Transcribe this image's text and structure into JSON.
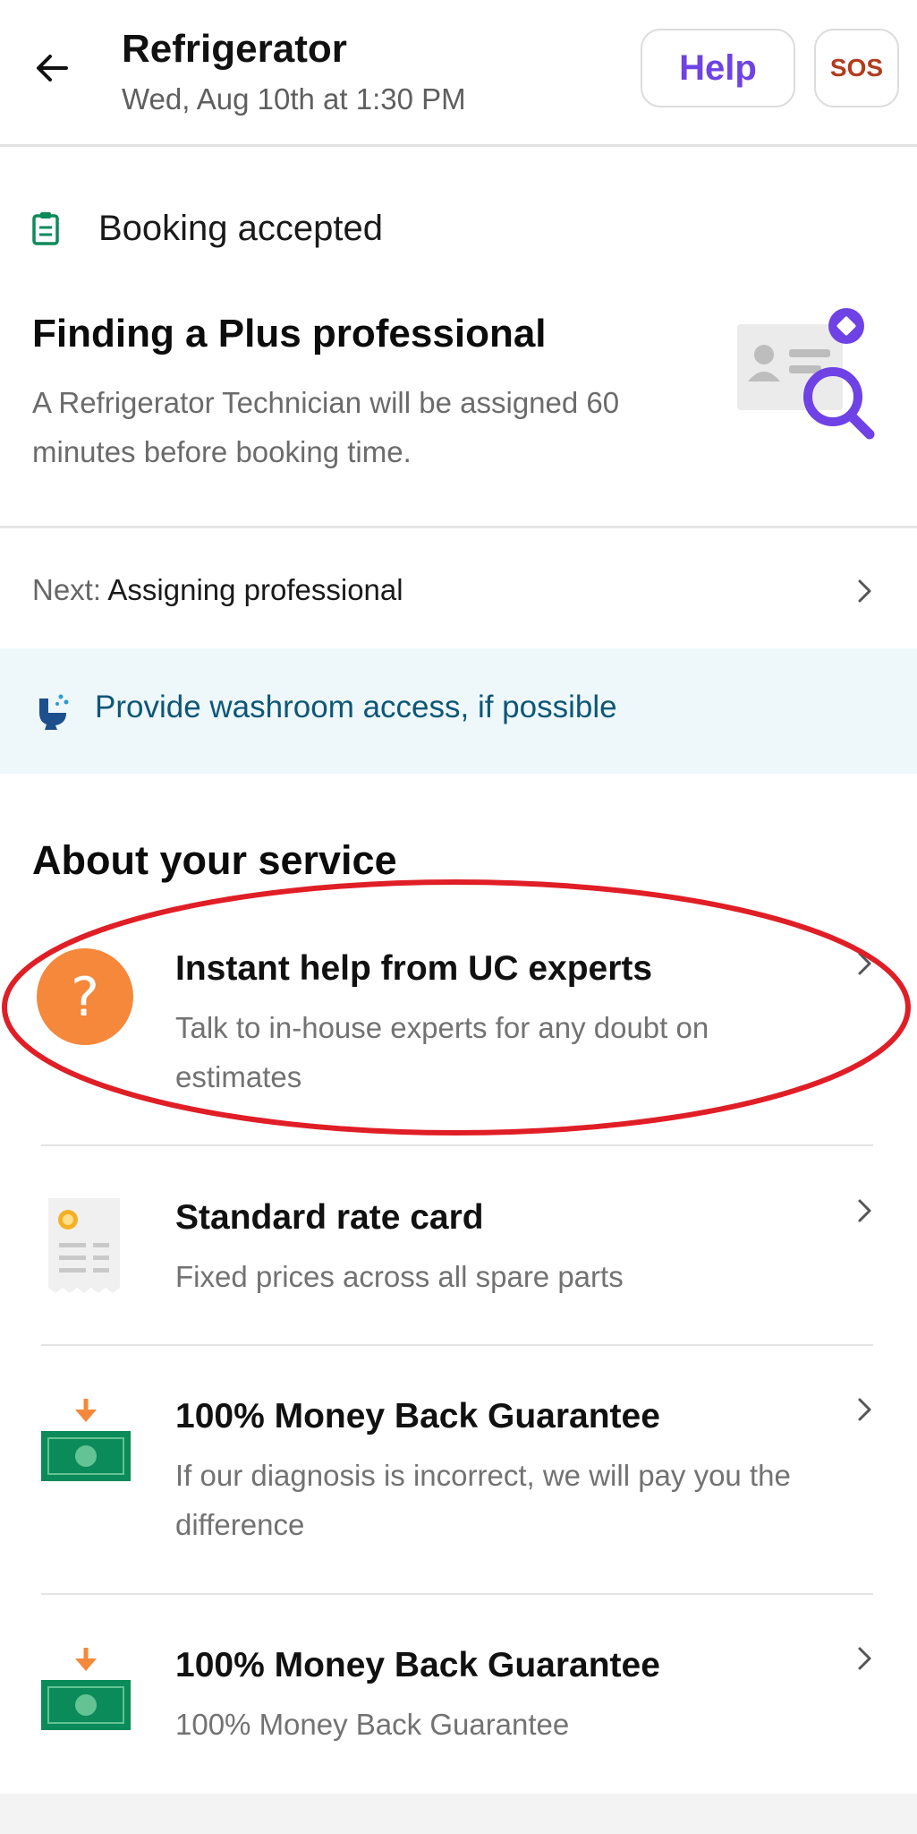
{
  "header": {
    "title": "Refrigerator",
    "subtitle": "Wed, Aug 10th at 1:30 PM",
    "help_label": "Help",
    "sos_label": "SOS"
  },
  "status": {
    "label": "Booking accepted",
    "title": "Finding a Plus professional",
    "description": "A Refrigerator Technician will be assigned 60 minutes before booking time."
  },
  "next": {
    "prefix": "Next:",
    "value": "Assigning professional"
  },
  "banner": {
    "text": "Provide washroom access, if possible"
  },
  "service": {
    "section_title": "About your service",
    "items": [
      {
        "title": "Instant help from UC experts",
        "description": "Talk to in-house experts for any doubt on estimates",
        "icon": "question-mark-icon"
      },
      {
        "title": "Standard rate card",
        "description": "Fixed prices across all spare parts",
        "icon": "rate-card-icon"
      },
      {
        "title": "100% Money Back Guarantee",
        "description": "If our diagnosis is incorrect, we will pay you the difference",
        "icon": "money-back-icon"
      },
      {
        "title": "100% Money Back Guarantee",
        "description": "100% Money Back Guarantee",
        "icon": "money-back-icon"
      }
    ]
  },
  "colors": {
    "accent": "#6e42e5",
    "sos": "#b23b1e",
    "booking_icon": "#0b8a5a",
    "banner_bg": "#eef8fb",
    "banner_text": "#0e5677",
    "question_icon": "#f5883b",
    "money_green": "#0b8a5a",
    "money_arrow": "#f5883b",
    "highlight_annotation": "#e01e26"
  }
}
